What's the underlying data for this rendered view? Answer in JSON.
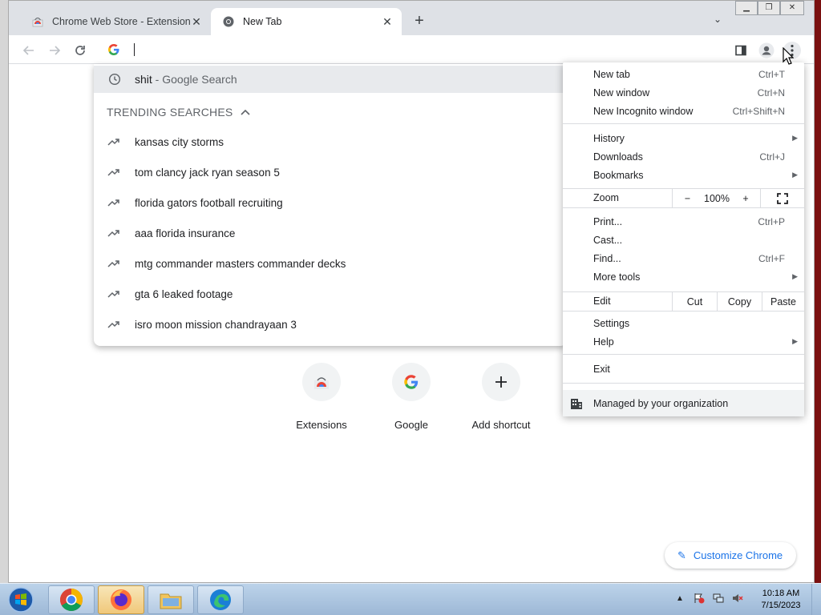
{
  "tabs": [
    {
      "title": "Chrome Web Store - Extensions",
      "active": false,
      "icon": "chrome-web-store-icon"
    },
    {
      "title": "New Tab",
      "active": true,
      "icon": "chrome-icon"
    }
  ],
  "omnibox": {
    "value": "",
    "icon": "google-g-icon"
  },
  "suggestion": {
    "query": "shit",
    "suffix": " - Google Search"
  },
  "trending": {
    "heading": "TRENDING SEARCHES",
    "items": [
      "kansas city storms",
      "tom clancy jack ryan season 5",
      "florida gators football recruiting",
      "aaa florida insurance",
      "mtg commander masters commander decks",
      "gta 6 leaked footage",
      "isro moon mission chandrayaan 3"
    ]
  },
  "shortcuts": [
    {
      "label": "Extensions",
      "icon": "chrome-web-store-icon"
    },
    {
      "label": "Google",
      "icon": "google-g-icon"
    },
    {
      "label": "Add shortcut",
      "icon": "plus-icon"
    }
  ],
  "customize_label": "Customize Chrome",
  "menu": {
    "new_tab": {
      "label": "New tab",
      "shortcut": "Ctrl+T"
    },
    "new_window": {
      "label": "New window",
      "shortcut": "Ctrl+N"
    },
    "new_incognito": {
      "label": "New Incognito window",
      "shortcut": "Ctrl+Shift+N"
    },
    "history": {
      "label": "History"
    },
    "downloads": {
      "label": "Downloads",
      "shortcut": "Ctrl+J"
    },
    "bookmarks": {
      "label": "Bookmarks"
    },
    "zoom": {
      "label": "Zoom",
      "minus": "−",
      "value": "100%",
      "plus": "+"
    },
    "print": {
      "label": "Print...",
      "shortcut": "Ctrl+P"
    },
    "cast": {
      "label": "Cast..."
    },
    "find": {
      "label": "Find...",
      "shortcut": "Ctrl+F"
    },
    "more_tools": {
      "label": "More tools"
    },
    "edit": {
      "label": "Edit",
      "cut": "Cut",
      "copy": "Copy",
      "paste": "Paste"
    },
    "settings": {
      "label": "Settings"
    },
    "help": {
      "label": "Help"
    },
    "exit": {
      "label": "Exit"
    },
    "managed": {
      "label": "Managed by your organization"
    }
  },
  "taskbar": {
    "time": "10:18 AM",
    "date": "7/15/2023",
    "apps": [
      "chrome-icon",
      "firefox-icon",
      "file-explorer-icon",
      "edge-icon"
    ]
  }
}
